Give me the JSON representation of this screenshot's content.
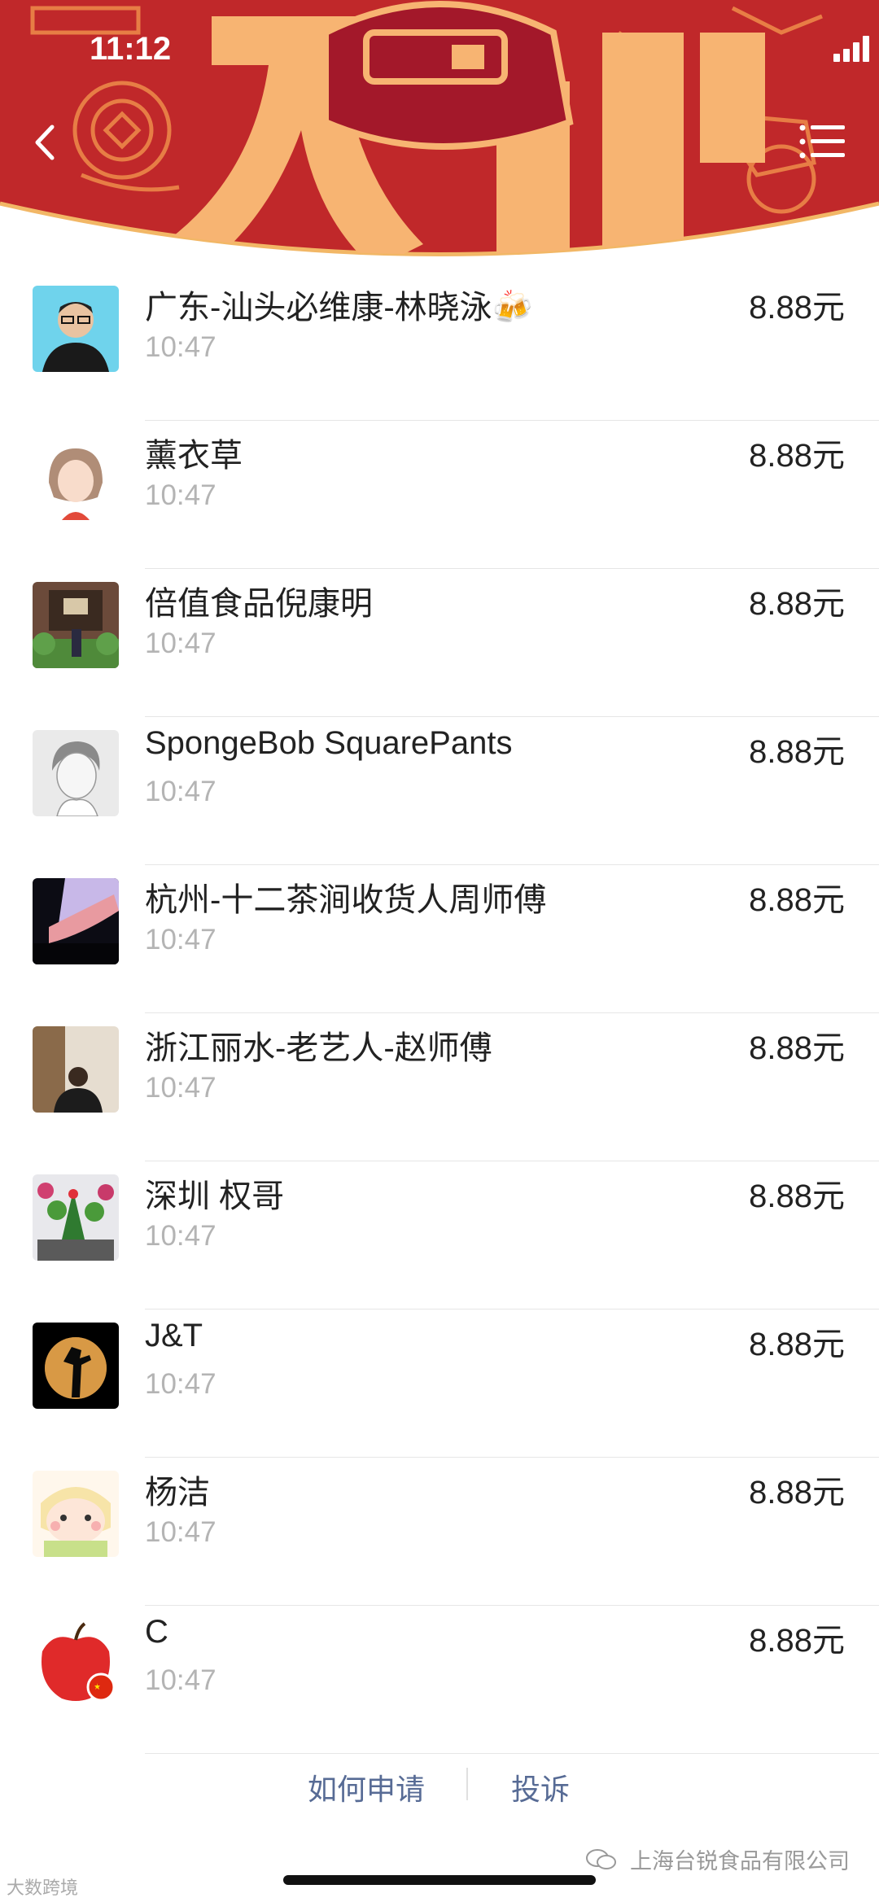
{
  "status_bar": {
    "time": "11:12"
  },
  "header": {
    "banner_text": "大利"
  },
  "records": [
    {
      "name": "广东-汕头必维康-林晓泳🍻",
      "time": "10:47",
      "amount": "8.88元"
    },
    {
      "name": "薰衣草",
      "time": "10:47",
      "amount": "8.88元"
    },
    {
      "name": "倍值食品倪康明",
      "time": "10:47",
      "amount": "8.88元"
    },
    {
      "name": "SpongeBob SquarePants",
      "time": "10:47",
      "amount": "8.88元"
    },
    {
      "name": "杭州-十二茶涧收货人周师傅",
      "time": "10:47",
      "amount": "8.88元"
    },
    {
      "name": "浙江丽水-老艺人-赵师傅",
      "time": "10:47",
      "amount": "8.88元"
    },
    {
      "name": "深圳 权哥",
      "time": "10:47",
      "amount": "8.88元"
    },
    {
      "name": "J&T",
      "time": "10:47",
      "amount": "8.88元"
    },
    {
      "name": "杨洁",
      "time": "10:47",
      "amount": "8.88元"
    },
    {
      "name": "C",
      "time": "10:47",
      "amount": "8.88元"
    }
  ],
  "footer": {
    "how_to_apply": "如何申请",
    "complain": "投诉"
  },
  "watermark": {
    "right": "上海台锐食品有限公司",
    "left": "大数跨境"
  },
  "colors": {
    "banner_red": "#c0282a",
    "banner_gold": "#f7b472",
    "link_blue": "#576b95"
  }
}
